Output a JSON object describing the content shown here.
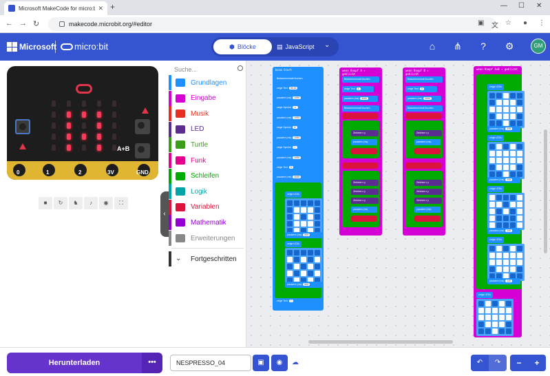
{
  "browser": {
    "tab_title": "Microsoft MakeCode for micro:bit",
    "new_tab_symbol": "+",
    "url": "makecode.microbit.org/#editor",
    "avatar": "GM"
  },
  "header": {
    "brand": "Microsoft",
    "product": "micro:bit",
    "blocks_label": "Blöcke",
    "javascript_label": "JavaScript",
    "user_initials": "GM"
  },
  "simulator": {
    "button_ab_label": "A+B",
    "pins": [
      "0",
      "1",
      "2",
      "3V",
      "GND"
    ],
    "led_matrix": [
      [
        0,
        0,
        0,
        0,
        0
      ],
      [
        0,
        1,
        1,
        1,
        0
      ],
      [
        0,
        1,
        0,
        1,
        0
      ],
      [
        0,
        1,
        1,
        1,
        0
      ],
      [
        0,
        1,
        0,
        1,
        0
      ]
    ]
  },
  "toolbox": {
    "search_placeholder": "Suche...",
    "categories": [
      {
        "label": "Grundlagen",
        "color": "#1e90ff",
        "icon": "grid-icon"
      },
      {
        "label": "Eingabe",
        "color": "#d400d4",
        "icon": "target-icon"
      },
      {
        "label": "Musik",
        "color": "#e63022",
        "icon": "headphones-icon"
      },
      {
        "label": "LED",
        "color": "#5c2d91",
        "icon": "toggle-icon"
      },
      {
        "label": "Turtle",
        "color": "#3c9d1b",
        "icon": "turtle-icon"
      },
      {
        "label": "Funk",
        "color": "#e3008c",
        "icon": "signal-icon"
      },
      {
        "label": "Schleifen",
        "color": "#00aa00",
        "icon": "loop-icon"
      },
      {
        "label": "Logik",
        "color": "#00a4a6",
        "icon": "shuffle-icon"
      },
      {
        "label": "Variablen",
        "color": "#dc143c",
        "icon": "list-icon"
      },
      {
        "label": "Mathematik",
        "color": "#9400d3",
        "icon": "calculator-icon"
      },
      {
        "label": "Erweiterungen",
        "color": "#888888",
        "icon": "plus-circle-icon"
      }
    ],
    "advanced_label": "Fortgeschritten"
  },
  "workspace": {
    "blocks": [
      {
        "hat": "beim Start",
        "color": "#1e90ff"
      },
      {
        "hat": "wenn Knopf A ▾ geklickt",
        "color": "#d400d4"
      },
      {
        "hat": "wenn Knopf B ▾ geklickt",
        "color": "#d400d4"
      },
      {
        "hat": "wenn Knopf A+B ▾ geklickt",
        "color": "#d400d4"
      }
    ]
  },
  "bottom": {
    "download_label": "Herunterladen",
    "more_label": "•••",
    "project_name": "NESPRESSO_04"
  }
}
